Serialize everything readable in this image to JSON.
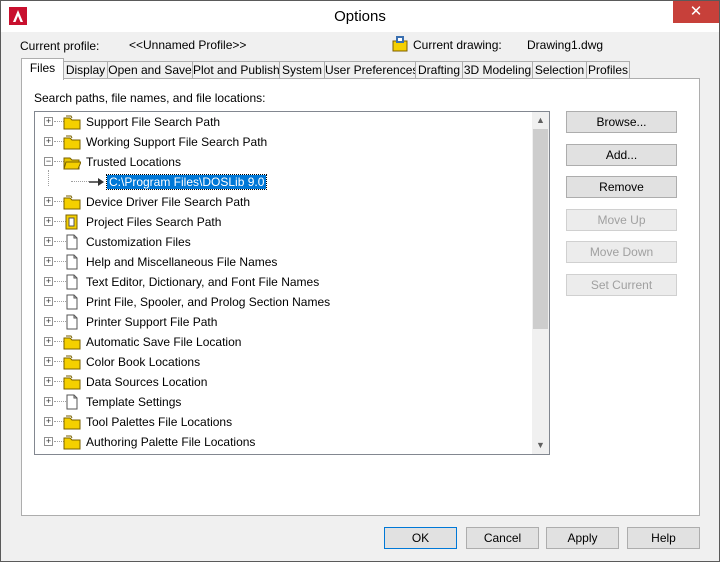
{
  "window": {
    "title": "Options",
    "close_glyph": "✕"
  },
  "profile": {
    "current_profile_label": "Current profile:",
    "current_profile_value": "<<Unnamed Profile>>",
    "current_drawing_label": "Current drawing:",
    "current_drawing_value": "Drawing1.dwg"
  },
  "tabs": [
    {
      "label": "Files",
      "active": true
    },
    {
      "label": "Display"
    },
    {
      "label": "Open and Save"
    },
    {
      "label": "Plot and Publish"
    },
    {
      "label": "System"
    },
    {
      "label": "User Preferences"
    },
    {
      "label": "Drafting"
    },
    {
      "label": "3D Modeling"
    },
    {
      "label": "Selection"
    },
    {
      "label": "Profiles"
    }
  ],
  "files_panel": {
    "caption": "Search paths, file names, and file locations:",
    "tree": [
      {
        "label": "Support File Search Path",
        "icon": "folder-icon"
      },
      {
        "label": "Working Support File Search Path",
        "icon": "folder-icon"
      },
      {
        "label": "Trusted Locations",
        "icon": "folder-open-icon",
        "expanded": true
      },
      {
        "label": "C:\\Program Files\\DOSLib 9.0",
        "icon": "arrow-icon",
        "child": true,
        "selected": true
      },
      {
        "label": "Device Driver File Search Path",
        "icon": "folder-icon"
      },
      {
        "label": "Project Files Search Path",
        "icon": "project-icon"
      },
      {
        "label": "Customization Files",
        "icon": "file-icon"
      },
      {
        "label": "Help and Miscellaneous File Names",
        "icon": "file-icon"
      },
      {
        "label": "Text Editor, Dictionary, and Font File Names",
        "icon": "file-icon"
      },
      {
        "label": "Print File, Spooler, and Prolog Section Names",
        "icon": "file-icon"
      },
      {
        "label": "Printer Support File Path",
        "icon": "file-icon"
      },
      {
        "label": "Automatic Save File Location",
        "icon": "folder-icon"
      },
      {
        "label": "Color Book Locations",
        "icon": "folder-icon"
      },
      {
        "label": "Data Sources Location",
        "icon": "folder-icon"
      },
      {
        "label": "Template Settings",
        "icon": "file-icon"
      },
      {
        "label": "Tool Palettes File Locations",
        "icon": "folder-icon"
      },
      {
        "label": "Authoring Palette File Locations",
        "icon": "folder-icon"
      }
    ],
    "buttons": {
      "browse": "Browse...",
      "add": "Add...",
      "remove": "Remove",
      "move_up": "Move Up",
      "move_down": "Move Down",
      "set_current": "Set Current"
    }
  },
  "footer": {
    "ok": "OK",
    "cancel": "Cancel",
    "apply": "Apply",
    "help": "Help"
  },
  "colors": {
    "selection": "#0078d7",
    "folder": "#f5d000",
    "close": "#c7403a"
  }
}
